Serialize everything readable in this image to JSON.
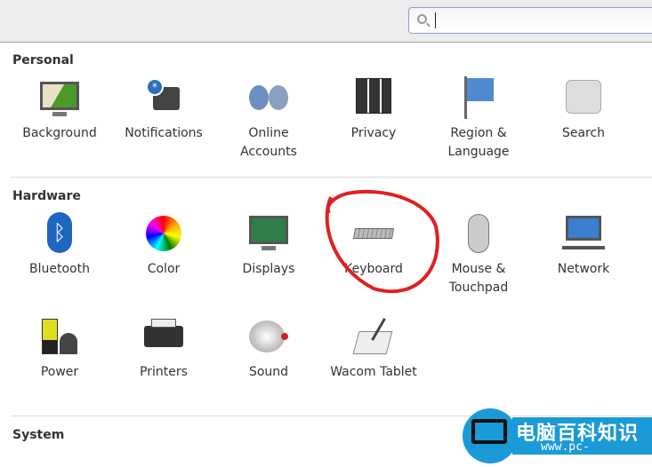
{
  "search": {
    "placeholder": "",
    "value": ""
  },
  "sections": {
    "personal": {
      "title": "Personal",
      "items": [
        {
          "label": "Background",
          "icon": "background-icon"
        },
        {
          "label": "Notifications",
          "icon": "notifications-icon"
        },
        {
          "label": "Online\nAccounts",
          "icon": "online-accounts-icon"
        },
        {
          "label": "Privacy",
          "icon": "privacy-icon"
        },
        {
          "label": "Region &\nLanguage",
          "icon": "region-flag-icon"
        },
        {
          "label": "Search",
          "icon": "search-icon"
        }
      ]
    },
    "hardware": {
      "title": "Hardware",
      "items": [
        {
          "label": "Bluetooth",
          "icon": "bluetooth-icon"
        },
        {
          "label": "Color",
          "icon": "color-icon"
        },
        {
          "label": "Displays",
          "icon": "displays-icon"
        },
        {
          "label": "Keyboard",
          "icon": "keyboard-icon"
        },
        {
          "label": "Mouse &\nTouchpad",
          "icon": "mouse-icon"
        },
        {
          "label": "Network",
          "icon": "network-icon"
        },
        {
          "label": "Power",
          "icon": "power-icon"
        },
        {
          "label": "Printers",
          "icon": "printer-icon"
        },
        {
          "label": "Sound",
          "icon": "sound-icon"
        },
        {
          "label": "Wacom Tablet",
          "icon": "wacom-icon"
        }
      ]
    },
    "system": {
      "title": "System"
    }
  },
  "annotation": {
    "color": "#e02020",
    "target": "Keyboard"
  },
  "watermark": {
    "title": "电脑百科知识",
    "url": "www.pc-daily.com"
  }
}
